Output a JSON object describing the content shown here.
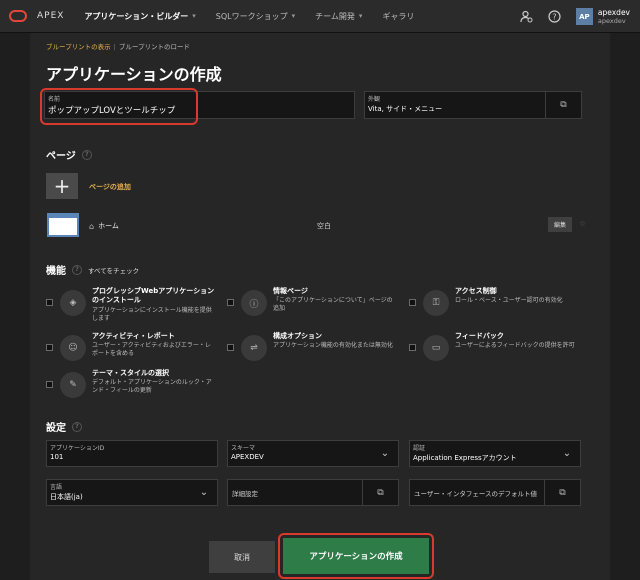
{
  "topbar": {
    "brand": "APEX",
    "menus": [
      {
        "label": "アプリケーション・ビルダー",
        "active": true
      },
      {
        "label": "SQLワークショップ",
        "active": false
      },
      {
        "label": "チーム開発",
        "active": false
      },
      {
        "label": "ギャラリ",
        "active": false
      }
    ],
    "avatar_initials": "AP",
    "user_name": "apexdev",
    "user_workspace": "apexdev",
    "icons": [
      "oracle-logo-icon",
      "user-settings-icon",
      "help-icon"
    ]
  },
  "breadcrumb": {
    "items": [
      "ブループリントの表示",
      "ブループリントのロード"
    ]
  },
  "page_title": "アプリケーションの作成",
  "name_field": {
    "label": "名前",
    "value": "ポップアップLOVとツールチップ"
  },
  "appearance_field": {
    "label": "外観",
    "value": "Vita, サイド・メニュー"
  },
  "pages_section": {
    "title": "ページ",
    "add_label": "ページの追加",
    "pages": [
      {
        "name": "ホーム",
        "type": "空白",
        "edit_label": "編集"
      }
    ]
  },
  "features_section": {
    "title": "機能",
    "check_all": "すべてをチェック",
    "items": [
      {
        "title": "プログレッシブWebアプリケーションのインストール",
        "desc": "アプリケーションにインストール機能を提供します",
        "icon": "package-icon"
      },
      {
        "title": "情報ページ",
        "desc": "「このアプリケーションについて」ページの追加",
        "icon": "info-icon"
      },
      {
        "title": "アクセス制御",
        "desc": "ロール・ベース・ユーザー認可の有効化",
        "icon": "key-icon"
      },
      {
        "title": "アクティビティ・レポート",
        "desc": "ユーザー・アクティビティおよびエラー・レポートを含める",
        "icon": "user-report-icon"
      },
      {
        "title": "構成オプション",
        "desc": "アプリケーション機能の有効化または無効化",
        "icon": "sliders-icon"
      },
      {
        "title": "フィードバック",
        "desc": "ユーザーによるフィードバックの提供を許可",
        "icon": "comment-icon"
      },
      {
        "title": "テーマ・スタイルの選択",
        "desc": "デフォルト・アプリケーションのルック・アンド・フィールの更新",
        "icon": "brush-icon"
      }
    ]
  },
  "settings_section": {
    "title": "設定",
    "app_id": {
      "label": "アプリケーションID",
      "value": "101"
    },
    "schema": {
      "label": "スキーマ",
      "value": "APEXDEV"
    },
    "auth": {
      "label": "認証",
      "value": "Application Expressアカウント"
    },
    "language": {
      "label": "言語",
      "value": "日本語(ja)"
    },
    "advanced": {
      "label": "詳細設定"
    },
    "ui_default": {
      "label": "ユーザー・インタフェースのデフォルト値"
    }
  },
  "buttons": {
    "cancel": "取消",
    "create": "アプリケーションの作成"
  },
  "colors": {
    "accent_link": "#e6b34a",
    "create_button": "#2e7d48",
    "highlight_ring": "#d83a2e",
    "background": "#1e1e1e"
  }
}
